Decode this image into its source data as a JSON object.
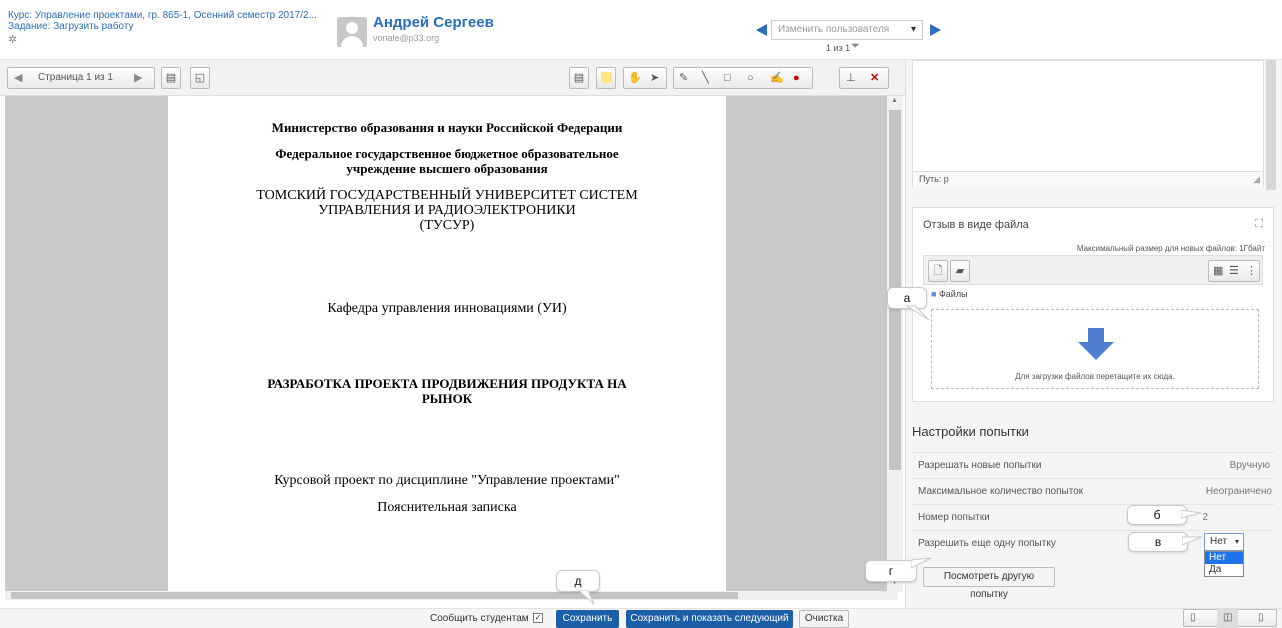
{
  "header": {
    "course": "Курс: Управление проектами, гр. 865-1, Осенний семестр 2017/2...",
    "assignment": "Задание: Загрузить работу",
    "user_name": "Андрей Сергеев",
    "user_email": "vonale@p33.org",
    "change_user_placeholder": "Изменить пользователя",
    "pager": "1 из 1"
  },
  "toolbar": {
    "page_label": "Страница 1 из 1"
  },
  "document": {
    "line1": "Министерство образования и науки Российской Федерации",
    "line2": "Федеральное государственное бюджетное образовательное",
    "line3": "учреждение высшего образования",
    "line4": "ТОМСКИЙ ГОСУДАРСТВЕННЫЙ УНИВЕРСИТЕТ СИСТЕМ",
    "line5": "УПРАВЛЕНИЯ И РАДИОЭЛЕКТРОНИКИ",
    "line6": "(ТУСУР)",
    "line7": "Кафедра управления инновациями (УИ)",
    "line8": "РАЗРАБОТКА ПРОЕКТА ПРОДВИЖЕНИЯ ПРОДУКТА НА",
    "line9": "РЫНОК",
    "line10": "Курсовой проект по дисциплине \"Управление проектами\"",
    "line11": "Пояснительная записка"
  },
  "editor": {
    "path": "Путь: p"
  },
  "file_feedback": {
    "title": "Отзыв в виде файла",
    "max_size": "Максимальный размер для новых файлов: 1Гбайт",
    "folder": "Файлы",
    "drop_text": "Для загрузки файлов перетащите их сюда."
  },
  "attempt_settings": {
    "title": "Настройки попытки",
    "rows": [
      {
        "label": "Разрешать новые попытки",
        "value": "Вручную"
      },
      {
        "label": "Максимальное количество попыток",
        "value": "Неограничено"
      },
      {
        "label": "Номер попытки",
        "value": "2"
      },
      {
        "label": "Разрешить еще одну попытку",
        "value": "Нет"
      }
    ],
    "dropdown_options": [
      "Нет",
      "Да"
    ],
    "view_other_button": "Посмотреть другую попытку"
  },
  "callouts": {
    "a": "а",
    "b": "б",
    "v": "в",
    "g": "г",
    "d": "д"
  },
  "footer": {
    "notify_label": "Сообщить студентам",
    "save": "Сохранить",
    "save_next": "Сохранить и показать следующий",
    "clear": "Очистка"
  },
  "colors": {
    "link": "#2a6ebb",
    "primary_button": "#1b5fa8",
    "delete_icon": "#cc0000",
    "annotation_yellow": "#ffe680"
  }
}
